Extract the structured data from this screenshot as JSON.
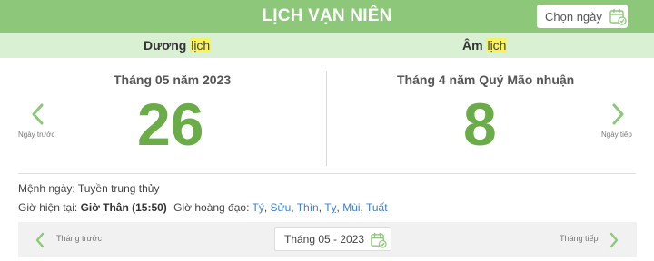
{
  "header": {
    "title": "LỊCH VẠN NIÊN",
    "choose_date_label": "Chọn ngày"
  },
  "tabs": {
    "solar_word": "Dương",
    "solar_highlight": "lịch",
    "lunar_word": "Âm",
    "lunar_highlight": "lịch"
  },
  "solar": {
    "month_label": "Tháng 05 năm 2023",
    "day": "26"
  },
  "lunar": {
    "month_label": "Tháng 4 năm Quý Mão nhuận",
    "day": "8"
  },
  "nav": {
    "prev_day": "Ngày trước",
    "next_day": "Ngày tiếp"
  },
  "info": {
    "menh_label": "Mệnh ngày:",
    "menh_value": "Tuyền trung thủy",
    "current_hour_label": "Giờ hiện tại:",
    "current_hour_value": "Giờ Thân (15:50)",
    "lucky_hours_label": "Giờ hoàng đạo:",
    "lucky_hours": [
      "Tý",
      "Sửu",
      "Thìn",
      "Tỵ",
      "Mùi",
      "Tuất"
    ]
  },
  "bottom": {
    "prev_month": "Tháng trước",
    "month_value": "Tháng 05 - 2023",
    "next_month": "Tháng tiếp"
  },
  "colors": {
    "header_green": "#8dc87a",
    "subheader_green": "#daf0d2",
    "day_green": "#6aad48",
    "highlight_yellow": "#f7f35c",
    "link_blue": "#3b7fd1"
  }
}
